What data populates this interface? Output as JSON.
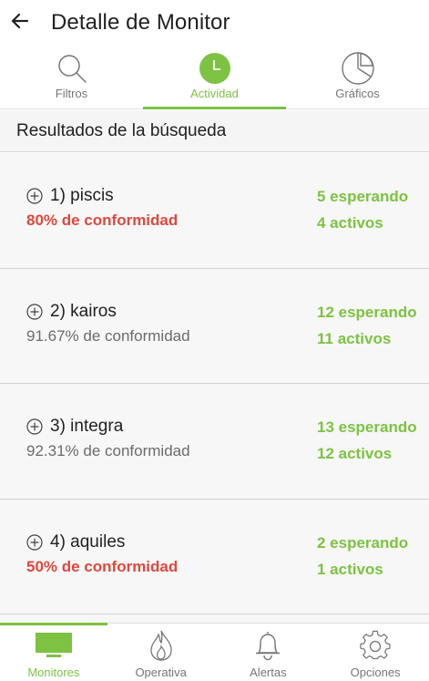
{
  "header": {
    "title": "Detalle de Monitor",
    "back_icon": "arrow-left-icon"
  },
  "tabs": [
    {
      "label": "Filtros",
      "icon": "search-icon",
      "active": false
    },
    {
      "label": "Actividad",
      "icon": "clock-icon",
      "active": true
    },
    {
      "label": "Gráficos",
      "icon": "pie-chart-icon",
      "active": false
    }
  ],
  "section": {
    "title": "Resultados de la búsqueda"
  },
  "results": [
    {
      "name": "1) piscis",
      "conformity": "80% de conformidad",
      "bad": true,
      "waiting": "5 esperando",
      "active": "4 activos"
    },
    {
      "name": "2) kairos",
      "conformity": "91.67% de conformidad",
      "bad": false,
      "waiting": "12 esperando",
      "active": "11 activos"
    },
    {
      "name": "3) integra",
      "conformity": "92.31% de conformidad",
      "bad": false,
      "waiting": "13 esperando",
      "active": "12 activos"
    },
    {
      "name": "4) aquiles",
      "conformity": "50% de conformidad",
      "bad": true,
      "waiting": "2 esperando",
      "active": "1 activos"
    }
  ],
  "bottom_nav": [
    {
      "label": "Monitores",
      "icon": "monitor-icon",
      "active": true
    },
    {
      "label": "Operativa",
      "icon": "flame-icon",
      "active": false
    },
    {
      "label": "Alertas",
      "icon": "bell-icon",
      "active": false
    },
    {
      "label": "Opciones",
      "icon": "gear-icon",
      "active": false
    }
  ],
  "colors": {
    "accent": "#7dc242",
    "warning": "#e0473c",
    "text": "#212121",
    "muted": "#757575",
    "list_bg": "#f7f7f7"
  }
}
